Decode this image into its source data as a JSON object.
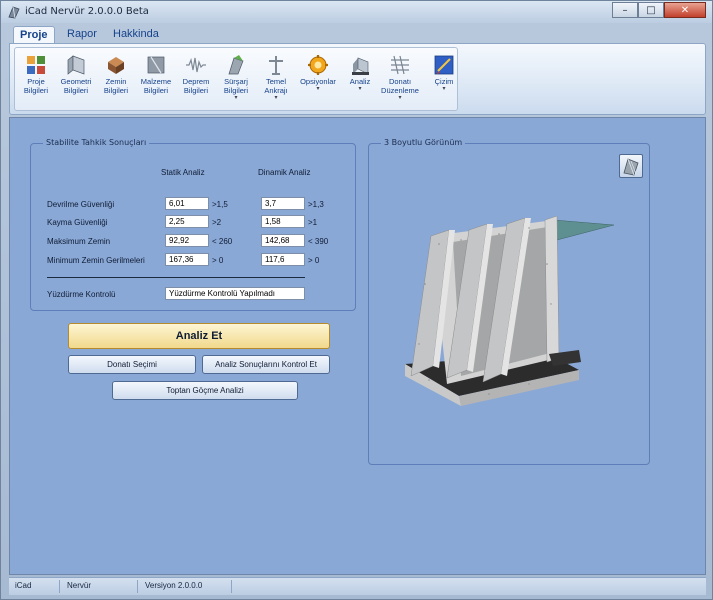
{
  "window": {
    "title": "iCad Nervür 2.0.0.0 Beta",
    "minimize_glyph": "–",
    "maximize_glyph": "□",
    "close_glyph": "✕"
  },
  "menu": {
    "tabs": [
      "Proje",
      "Rapor",
      "Hakkinda"
    ],
    "active_tab": "Proje"
  },
  "ribbon": {
    "buttons": [
      {
        "label1": "Proje",
        "label2": "Bilgileri",
        "icon": "project-icon",
        "dropdown": false
      },
      {
        "label1": "Geometri",
        "label2": "Bilgileri",
        "icon": "geometry-icon",
        "dropdown": false
      },
      {
        "label1": "Zemin",
        "label2": "Bilgileri",
        "icon": "soil-icon",
        "dropdown": false
      },
      {
        "label1": "Malzeme",
        "label2": "Bilgileri",
        "icon": "material-icon",
        "dropdown": false
      },
      {
        "label1": "Deprem",
        "label2": "Bilgileri",
        "icon": "earthquake-icon",
        "dropdown": false
      },
      {
        "label1": "Sürşarj",
        "label2": "Bilgileri",
        "icon": "surcharge-icon",
        "dropdown": true
      },
      {
        "label1": "Temel",
        "label2": "Ankrajı",
        "icon": "anchor-icon",
        "dropdown": true
      },
      {
        "label1": "Opsiyonlar",
        "label2": "",
        "icon": "gear-icon",
        "dropdown": true
      },
      {
        "label1": "Analiz",
        "label2": "",
        "icon": "analysis-icon",
        "dropdown": true
      },
      {
        "label1": "Donatı",
        "label2": "Düzenleme",
        "icon": "rebar-icon",
        "dropdown": true
      },
      {
        "label1": "Çizim",
        "label2": "",
        "icon": "drawing-icon",
        "dropdown": true
      }
    ],
    "dropdown_glyph": "▾"
  },
  "stability": {
    "title": "Stabilite Tahkik Sonuçları",
    "col_static": "Statik Analiz",
    "col_dynamic": "Dinamik Analiz",
    "rows": [
      {
        "label": "Devrilme Güvenliği",
        "static_value": "6,01",
        "static_limit": ">1,5",
        "dynamic_value": "3,7",
        "dynamic_limit": ">1,3"
      },
      {
        "label": "Kayma Güvenliği",
        "static_value": "2,25",
        "static_limit": ">2",
        "dynamic_value": "1,58",
        "dynamic_limit": ">1"
      },
      {
        "label": "Maksimum Zemin",
        "static_value": "92,92",
        "static_limit": "< 260",
        "dynamic_value": "142,68",
        "dynamic_limit": "< 390"
      },
      {
        "label": "Minimum Zemin Gerilmeleri",
        "static_value": "167,36",
        "static_limit": "> 0",
        "dynamic_value": "117,6",
        "dynamic_limit": "> 0"
      }
    ],
    "punching_label": "Yüzdürme Kontrolü",
    "punching_value": "Yüzdürme Kontrolü Yapılmadı"
  },
  "actions": {
    "analyze": "Analiz Et",
    "rebar_selection": "Donatı Seçimi",
    "check_results": "Analiz Sonuçlarını Kontrol Et",
    "collapse_analysis": "Toptan Göçme Analizi"
  },
  "view3d": {
    "title": "3 Boyutlu Görünüm",
    "view_button_icon": "cube-view-icon"
  },
  "status": {
    "app": "iCad",
    "module": "Nervür",
    "version": "Versiyon 2.0.0.0"
  }
}
